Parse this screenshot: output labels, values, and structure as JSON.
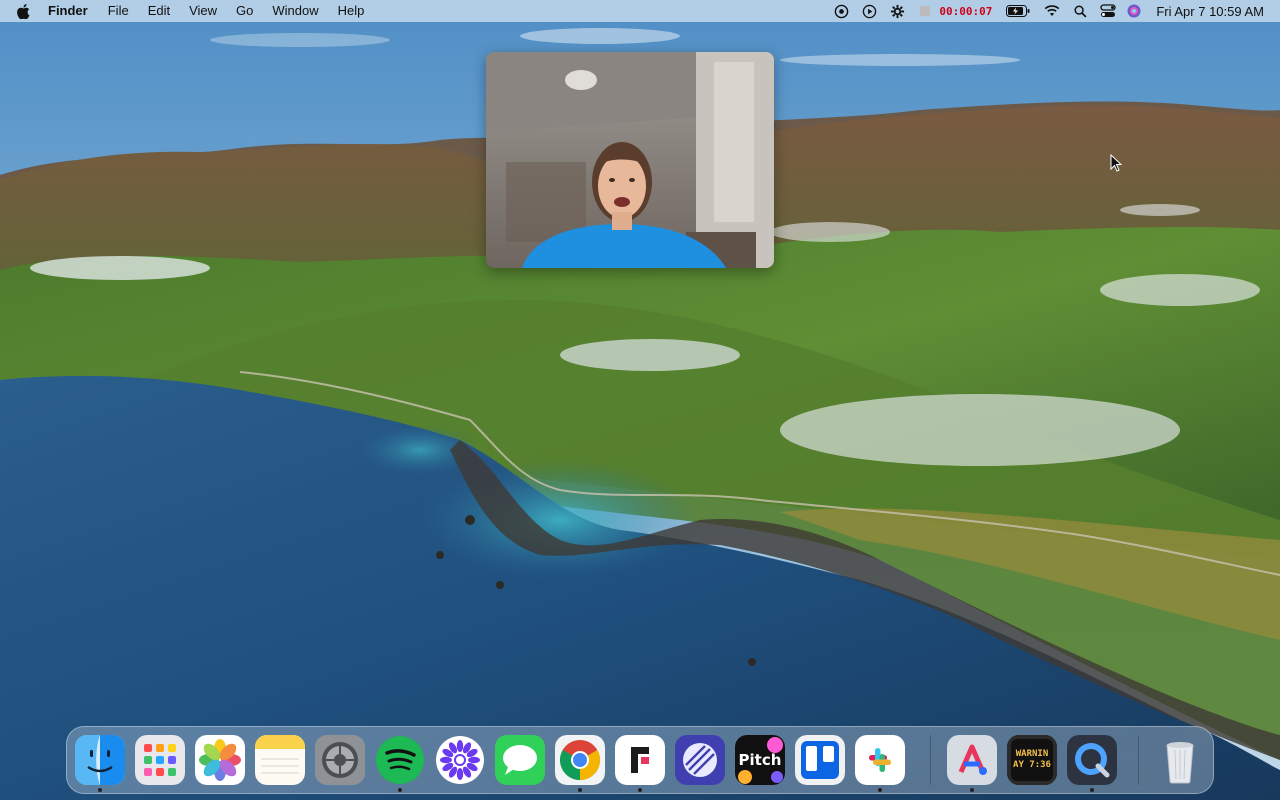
{
  "menubar": {
    "app_name": "Finder",
    "menus": [
      "File",
      "Edit",
      "View",
      "Go",
      "Window",
      "Help"
    ],
    "recording_timer": "00:00:07",
    "clock": "Fri Apr 7  10:59 AM",
    "status_icons": [
      "screen-share-icon",
      "play-icon",
      "gear-icon",
      "stop-recording-icon",
      "battery-icon",
      "wifi-icon",
      "search-icon",
      "control-center-icon",
      "siri-icon"
    ]
  },
  "camera": {
    "description_visible": false
  },
  "dock": {
    "items": [
      {
        "name": "Finder",
        "icon": "finder-icon",
        "running": true
      },
      {
        "name": "Launchpad",
        "icon": "launchpad-icon",
        "running": false
      },
      {
        "name": "Photos",
        "icon": "photos-icon",
        "running": false
      },
      {
        "name": "Notes",
        "icon": "notes-icon",
        "running": false
      },
      {
        "name": "System Preferences",
        "icon": "system-preferences-icon",
        "running": false
      },
      {
        "name": "Spotify",
        "icon": "spotify-icon",
        "running": true
      },
      {
        "name": "Perplexity",
        "icon": "perplexity-icon",
        "running": false
      },
      {
        "name": "Messages",
        "icon": "messages-icon",
        "running": false
      },
      {
        "name": "Chrome",
        "icon": "chrome-icon",
        "running": true
      },
      {
        "name": "Fathom",
        "icon": "fathom-icon",
        "running": true
      },
      {
        "name": "Linear",
        "icon": "linear-icon",
        "running": false
      },
      {
        "name": "Pitch",
        "icon": "pitch-icon",
        "running": false
      },
      {
        "name": "Trello",
        "icon": "trello-icon",
        "running": false
      },
      {
        "name": "Slack",
        "icon": "slack-icon",
        "running": true
      },
      {
        "name": "App",
        "icon": "app-icon",
        "running": true
      },
      {
        "name": "Console",
        "icon": "console-icon",
        "running": false
      },
      {
        "name": "QuickTime",
        "icon": "quicktime-icon",
        "running": true
      },
      {
        "name": "Trash",
        "icon": "trash-icon",
        "running": false
      }
    ],
    "pitch_label": "Pitch",
    "console_text": "WARNIN\nAY 7:36"
  },
  "colors": {
    "spotify": "#1db954",
    "messages": "#30d158",
    "trello": "#0c66e4",
    "recording": "#d0021b"
  }
}
